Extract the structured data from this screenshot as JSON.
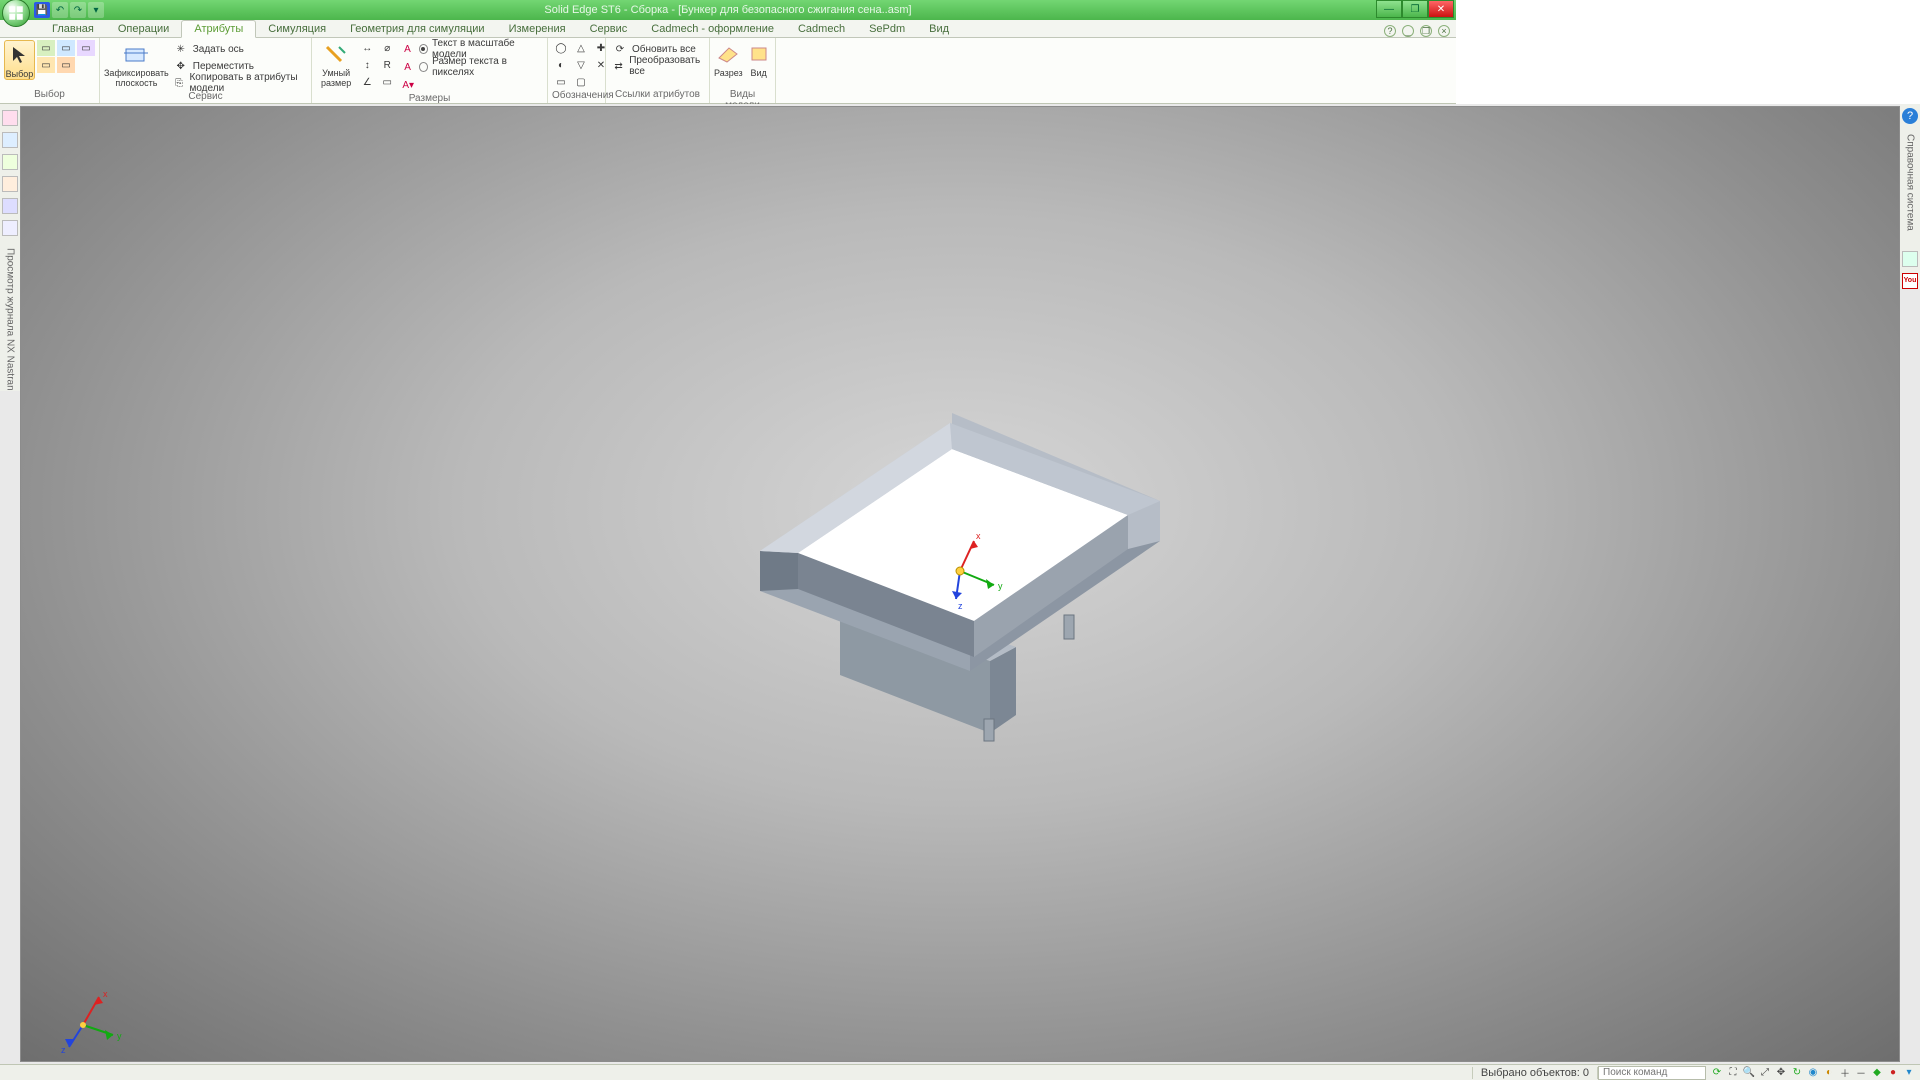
{
  "title": "Solid Edge ST6 - Сборка - [Бункер для безопасного сжигания сена..asm]",
  "tabs": [
    "Главная",
    "Операции",
    "Атрибуты",
    "Симуляция",
    "Геометрия для симуляции",
    "Измерения",
    "Сервис",
    "Cadmech - оформление",
    "Cadmech",
    "SePdm",
    "Вид"
  ],
  "active_tab": 2,
  "ribbon": {
    "select_group": "Выбор",
    "select_btn": "Выбор",
    "service_group": "Сервис",
    "fix_plane": "Зафиксировать плоскость",
    "set_axis": "Задать ось",
    "move": "Переместить",
    "copy_to_attrs": "Копировать в атрибуты модели",
    "smart_dim_group": "Размеры",
    "smart_dim": "Умный размер",
    "text_model_scale": "Текст в масштабе модели",
    "text_pixel_size": "Размер текста в пикселях",
    "annot_group": "Обозначения",
    "links_group": "Ссылки атрибутов",
    "refresh_all": "Обновить все",
    "convert_all": "Преобразовать все",
    "views_group": "Виды модели",
    "section": "Разрез",
    "view": "Вид"
  },
  "left_panel": "Просмотр журнала NX Nastran",
  "right_panel": "Справочная система",
  "axes": {
    "x": "x",
    "y": "y",
    "z": "z"
  },
  "status": {
    "selection": "Выбрано объектов: 0",
    "search_placeholder": "Поиск команд"
  }
}
